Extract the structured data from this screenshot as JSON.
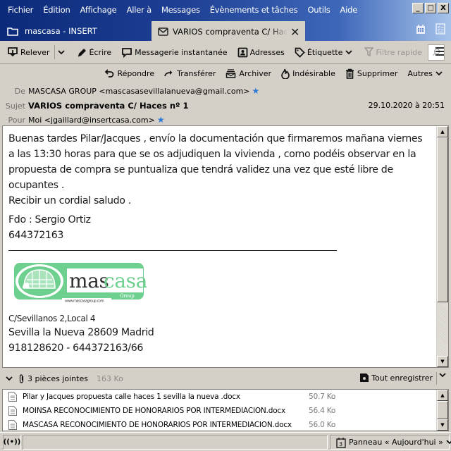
{
  "menubar": {
    "items": [
      {
        "label": "Fichier"
      },
      {
        "label": "Édition"
      },
      {
        "label": "Affichage"
      },
      {
        "label": "Aller à"
      },
      {
        "label": "Messages"
      },
      {
        "label": "Évènements et tâches"
      },
      {
        "label": "Outils"
      },
      {
        "label": "Aide"
      }
    ],
    "window_controls": {
      "minimize": "_",
      "maximize": "□",
      "close": "X"
    }
  },
  "tabs": [
    {
      "label": "mascasa - INSERT",
      "icon": "folder-icon",
      "active": false
    },
    {
      "label": "VARIOS compraventa C/ Haces nº 1",
      "icon": "envelope-icon",
      "active": true,
      "close": "✕"
    }
  ],
  "tabbar_icons": [
    "calendar-icon",
    "tasks-icon"
  ],
  "toolbar": {
    "get_messages": "Relever",
    "write": "Écrire",
    "chat": "Messagerie instantanée",
    "address_book": "Adresses",
    "tag": "Étiquette",
    "quick_filter": "Filtre rapide"
  },
  "message": {
    "actions": {
      "reply": "Répondre",
      "forward": "Transférer",
      "archive": "Archiver",
      "junk": "Indésirable",
      "delete": "Supprimer",
      "more": "Autres"
    },
    "from_label": "De",
    "from": "MASCASA GROUP <mascasasevillalanueva@gmail.com>",
    "subject_label": "Sujet",
    "subject": "VARIOS compraventa C/ Haces nº 1",
    "date": "29.10.2020 à 20:51",
    "to_label": "Pour",
    "to": "Moi <jgaillard@insertcasa.com>",
    "body": {
      "lines": [
        "Buenas tardes Pilar/Jacques , envío la documentación que firmaremos mañana viernes",
        "a las 13:30 horas para que se os adjudiquen la vivienda , como podéis observar  en la",
        "propuesta de compra se puntualiza que tendrá validez  una vez que esté libre de",
        "ocupantes .",
        "Recibir un cordial saludo ."
      ],
      "signature": "Fdo : Sergio Ortiz",
      "phone": "644372163",
      "logo": {
        "brand_dark": "mas",
        "brand_light": "casa",
        "tag": "Group",
        "url": "www.mascasagroup.com"
      },
      "address_line1": "C/Sevillanos 2,Local 4",
      "address_line2": "Sevilla la Nueva 28609 Madrid",
      "address_line3": "918128620 - 644372163/66"
    }
  },
  "attachments": {
    "summary": "3 pièces jointes",
    "total_size": "163 Ko",
    "save_all": "Tout enregistrer",
    "items": [
      {
        "name": "Pilar y Jacques propuesta calle haces 1 sevilla la nueva .docx",
        "size": "50.7 Ko"
      },
      {
        "name": "MOINSA RECONOCIMIENTO DE HONORARIOS POR INTERMEDIACION.docx",
        "size": "56.4 Ko"
      },
      {
        "name": "MASCASA RECONOCIMIENTO DE HONORARIOS POR INTERMEDIACION.docx",
        "size": "56.0 Ko"
      }
    ]
  },
  "statusbar": {
    "today_pane": "Panneau « Aujourd'hui »",
    "calendar_day": "3"
  },
  "colors": {
    "menubar_dark": "#0c2a7a",
    "menubar_light": "#a6c3ea",
    "chrome": "#d4d0c8",
    "star": "#2a7ad6",
    "logo_green": "#6ed08e"
  }
}
